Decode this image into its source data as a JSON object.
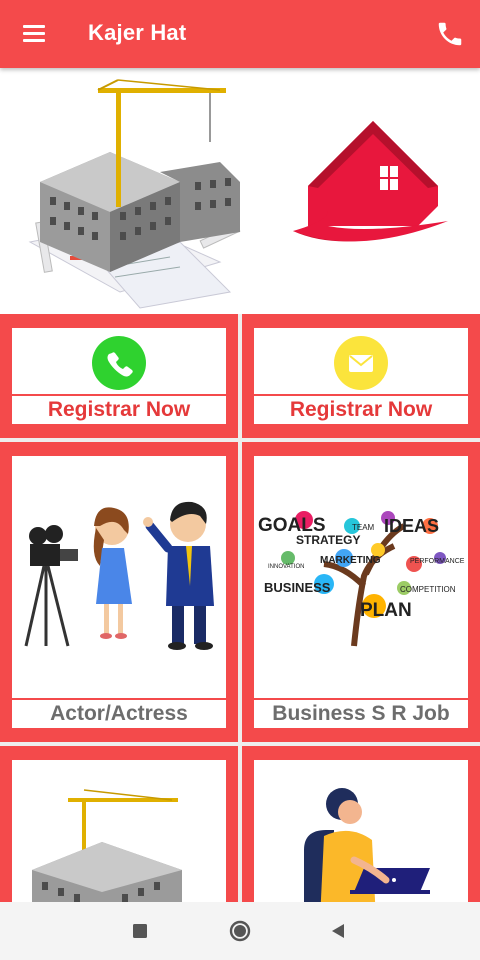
{
  "app": {
    "title": "Kajer Hat"
  },
  "icons": {
    "menu": "menu-icon",
    "phone": "phone-icon",
    "call": "call-icon",
    "mail": "mail-icon"
  },
  "colors": {
    "primary": "#f44a4b",
    "call_green": "#2fd22f",
    "mail_yellow": "#fbe43c",
    "label_red": "#e5393a",
    "label_gray": "#6d6d6d"
  },
  "cards": [
    {
      "label": "Registrar Now",
      "icon": "call-icon"
    },
    {
      "label": "Registrar Now",
      "icon": "mail-icon"
    },
    {
      "label": "Actor/Actress",
      "image": "actor-actress-illustration"
    },
    {
      "label": "Business S R Job",
      "image": "business-word-tree"
    },
    {
      "label": "",
      "image": "building-construction"
    },
    {
      "label": "",
      "image": "woman-laptop"
    }
  ],
  "business_words": [
    "GOALS",
    "STRATEGY",
    "TEAM",
    "IDEAS",
    "INNOVATION",
    "MARKETING",
    "PERFORMANCE",
    "BUSINESS",
    "COMPETITION",
    "PLAN"
  ]
}
